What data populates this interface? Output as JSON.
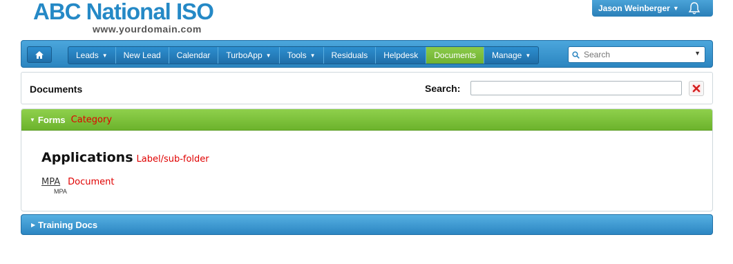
{
  "brand": {
    "name": "ABC National ISO",
    "domain": "www.yourdomain.com"
  },
  "user": {
    "name": "Jason Weinberger"
  },
  "nav": {
    "items": [
      {
        "label": "Leads",
        "dropdown": true
      },
      {
        "label": "New Lead",
        "dropdown": false
      },
      {
        "label": "Calendar",
        "dropdown": false
      },
      {
        "label": "TurboApp",
        "dropdown": true
      },
      {
        "label": "Tools",
        "dropdown": true
      },
      {
        "label": "Residuals",
        "dropdown": false
      },
      {
        "label": "Helpdesk",
        "dropdown": false
      },
      {
        "label": "Documents",
        "dropdown": false,
        "active": true
      },
      {
        "label": "Manage",
        "dropdown": true
      }
    ],
    "search_placeholder": "Search"
  },
  "documents_panel": {
    "title": "Documents",
    "search_label": "Search:",
    "search_value": ""
  },
  "forms_section": {
    "title": "Forms",
    "annotation": "Category",
    "subfolder": {
      "title": "Applications",
      "annotation": "Label/sub-folder"
    },
    "document": {
      "link": "MPA",
      "annotation": "Document",
      "subtitle": "MPA"
    }
  },
  "training_section": {
    "title": "Training Docs"
  },
  "colors": {
    "accent_blue": "#2b85c0",
    "active_green": "#7cbf3b",
    "annotation_red": "#e00000"
  }
}
